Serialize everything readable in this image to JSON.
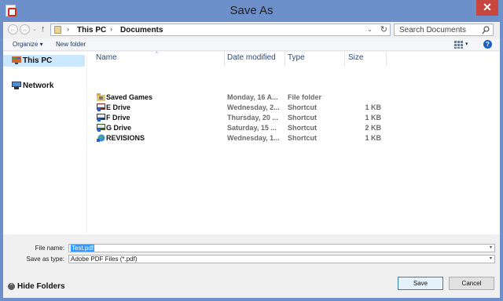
{
  "window": {
    "title": "Save As",
    "close_symbol": "✕"
  },
  "address": {
    "back_symbol": "←",
    "forward_symbol": "→",
    "history_symbol": "⌄",
    "up_symbol": "↑",
    "sep_symbol": "›",
    "crumbs": [
      "This PC",
      "Documents"
    ],
    "dropdown_symbol": "⌄",
    "refresh_symbol": "↻",
    "search_placeholder": "Search Documents"
  },
  "toolbar": {
    "organize_label": "Organize ▾",
    "new_folder_label": "New folder",
    "view_dd_symbol": "▾",
    "help_symbol": "?"
  },
  "navpane": {
    "items": [
      {
        "label": "This PC",
        "icon": "computer-icon",
        "selected": true
      },
      {
        "label": "Network",
        "icon": "network-icon",
        "selected": false
      }
    ]
  },
  "filelist": {
    "sort_symbol": "^",
    "columns": [
      "Name",
      "Date modified",
      "Type",
      "Size"
    ],
    "rows": [
      {
        "name": "Saved Games",
        "date": "Monday, 16 A...",
        "type": "File folder",
        "size": "",
        "icon": "saved-games-folder-icon"
      },
      {
        "name": "E Drive",
        "date": "Wednesday, 2...",
        "type": "Shortcut",
        "size": "1 KB",
        "icon": "drive-shortcut-icon"
      },
      {
        "name": "F Drive",
        "date": "Thursday, 20 ...",
        "type": "Shortcut",
        "size": "1 KB",
        "icon": "drive-shortcut-icon"
      },
      {
        "name": "G Drive",
        "date": "Saturday, 15 ...",
        "type": "Shortcut",
        "size": "2 KB",
        "icon": "drive-shortcut-icon"
      },
      {
        "name": "REVISIONS",
        "date": "Wednesday, 1...",
        "type": "Shortcut",
        "size": "1 KB",
        "icon": "globe-shortcut-icon"
      }
    ]
  },
  "form": {
    "file_name_label": "File name:",
    "file_name_value": "Test.pdf",
    "save_type_label": "Save as type:",
    "save_type_value": "Adobe PDF Files (*.pdf)",
    "dd_symbol": "▾"
  },
  "footer": {
    "hide_folders_symbol": "^",
    "hide_folders_label": "Hide Folders",
    "save_label": "Save",
    "cancel_label": "Cancel"
  }
}
